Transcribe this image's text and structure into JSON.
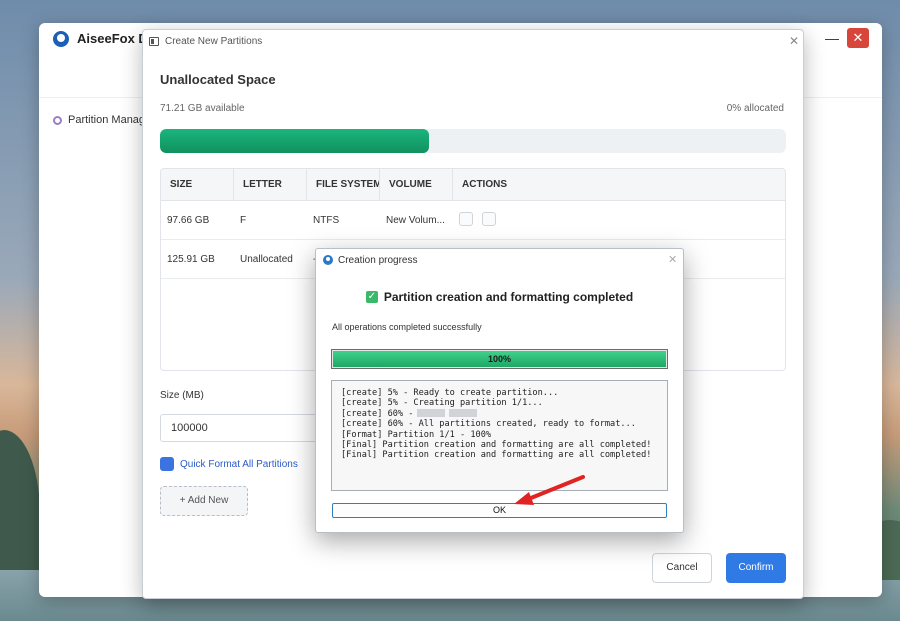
{
  "app": {
    "title": "AiseeFox Dr.F",
    "sidebar_item": "Partition Manage",
    "minimize_glyph": "—",
    "close_glyph": "✕",
    "top_icons": "⚲ ♡ ☰"
  },
  "create_dialog": {
    "title": "Create New Partitions",
    "section_title": "Unallocated Space",
    "available": "71.21 GB available",
    "allocated": "0% allocated",
    "space_used_fraction": 0.43,
    "table": {
      "headers": [
        "SIZE",
        "LETTER",
        "FILE SYSTEM",
        "VOLUME",
        "ACTIONS"
      ],
      "rows": [
        [
          "97.66 GB",
          "F",
          "NTFS",
          "New Volum..."
        ],
        [
          "125.91 GB",
          "Unallocated",
          "-",
          ""
        ]
      ]
    },
    "size_label": "Size (MB)",
    "size_value": "100000",
    "quick_format_label": "Quick Format All Partitions",
    "add_new_label": "+ Add New",
    "cancel_label": "Cancel",
    "confirm_label": "Confirm"
  },
  "progress_dialog": {
    "title": "Creation progress",
    "heading": "Partition creation and formatting completed",
    "status": "All operations completed successfully",
    "progress_percent": 100,
    "progress_label": "100%",
    "log_lines": [
      "[create] 5% - Ready to create partition...",
      "[create] 5% - Creating partition 1/1...",
      "[create] 60% -",
      "[create] 60% - All partitions created, ready to format...",
      "[Format] Partition 1/1 - 100%",
      "[Final] Partition creation and formatting are all completed!",
      "[Final] Partition creation and formatting are all completed!"
    ],
    "ok_label": "OK"
  },
  "colors": {
    "accent_blue": "#2f7ae5",
    "progress_green": "#1fa766",
    "annotation_red": "#e02424"
  }
}
